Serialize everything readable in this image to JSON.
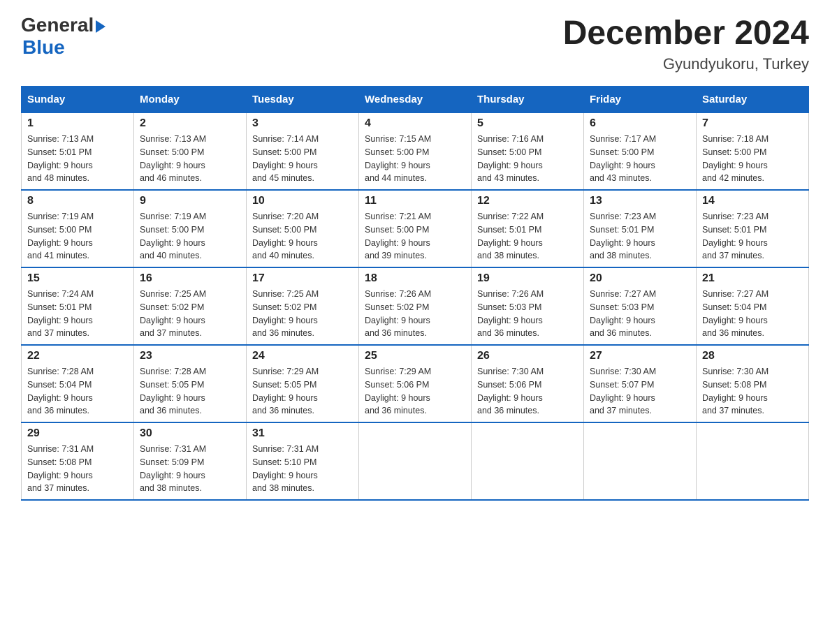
{
  "logo": {
    "text_general": "General",
    "text_blue": "Blue",
    "arrow": "▶"
  },
  "title": "December 2024",
  "subtitle": "Gyundyukoru, Turkey",
  "headers": [
    "Sunday",
    "Monday",
    "Tuesday",
    "Wednesday",
    "Thursday",
    "Friday",
    "Saturday"
  ],
  "weeks": [
    [
      {
        "day": "1",
        "sunrise": "7:13 AM",
        "sunset": "5:01 PM",
        "daylight": "9 hours and 48 minutes."
      },
      {
        "day": "2",
        "sunrise": "7:13 AM",
        "sunset": "5:00 PM",
        "daylight": "9 hours and 46 minutes."
      },
      {
        "day": "3",
        "sunrise": "7:14 AM",
        "sunset": "5:00 PM",
        "daylight": "9 hours and 45 minutes."
      },
      {
        "day": "4",
        "sunrise": "7:15 AM",
        "sunset": "5:00 PM",
        "daylight": "9 hours and 44 minutes."
      },
      {
        "day": "5",
        "sunrise": "7:16 AM",
        "sunset": "5:00 PM",
        "daylight": "9 hours and 43 minutes."
      },
      {
        "day": "6",
        "sunrise": "7:17 AM",
        "sunset": "5:00 PM",
        "daylight": "9 hours and 43 minutes."
      },
      {
        "day": "7",
        "sunrise": "7:18 AM",
        "sunset": "5:00 PM",
        "daylight": "9 hours and 42 minutes."
      }
    ],
    [
      {
        "day": "8",
        "sunrise": "7:19 AM",
        "sunset": "5:00 PM",
        "daylight": "9 hours and 41 minutes."
      },
      {
        "day": "9",
        "sunrise": "7:19 AM",
        "sunset": "5:00 PM",
        "daylight": "9 hours and 40 minutes."
      },
      {
        "day": "10",
        "sunrise": "7:20 AM",
        "sunset": "5:00 PM",
        "daylight": "9 hours and 40 minutes."
      },
      {
        "day": "11",
        "sunrise": "7:21 AM",
        "sunset": "5:00 PM",
        "daylight": "9 hours and 39 minutes."
      },
      {
        "day": "12",
        "sunrise": "7:22 AM",
        "sunset": "5:01 PM",
        "daylight": "9 hours and 38 minutes."
      },
      {
        "day": "13",
        "sunrise": "7:23 AM",
        "sunset": "5:01 PM",
        "daylight": "9 hours and 38 minutes."
      },
      {
        "day": "14",
        "sunrise": "7:23 AM",
        "sunset": "5:01 PM",
        "daylight": "9 hours and 37 minutes."
      }
    ],
    [
      {
        "day": "15",
        "sunrise": "7:24 AM",
        "sunset": "5:01 PM",
        "daylight": "9 hours and 37 minutes."
      },
      {
        "day": "16",
        "sunrise": "7:25 AM",
        "sunset": "5:02 PM",
        "daylight": "9 hours and 37 minutes."
      },
      {
        "day": "17",
        "sunrise": "7:25 AM",
        "sunset": "5:02 PM",
        "daylight": "9 hours and 36 minutes."
      },
      {
        "day": "18",
        "sunrise": "7:26 AM",
        "sunset": "5:02 PM",
        "daylight": "9 hours and 36 minutes."
      },
      {
        "day": "19",
        "sunrise": "7:26 AM",
        "sunset": "5:03 PM",
        "daylight": "9 hours and 36 minutes."
      },
      {
        "day": "20",
        "sunrise": "7:27 AM",
        "sunset": "5:03 PM",
        "daylight": "9 hours and 36 minutes."
      },
      {
        "day": "21",
        "sunrise": "7:27 AM",
        "sunset": "5:04 PM",
        "daylight": "9 hours and 36 minutes."
      }
    ],
    [
      {
        "day": "22",
        "sunrise": "7:28 AM",
        "sunset": "5:04 PM",
        "daylight": "9 hours and 36 minutes."
      },
      {
        "day": "23",
        "sunrise": "7:28 AM",
        "sunset": "5:05 PM",
        "daylight": "9 hours and 36 minutes."
      },
      {
        "day": "24",
        "sunrise": "7:29 AM",
        "sunset": "5:05 PM",
        "daylight": "9 hours and 36 minutes."
      },
      {
        "day": "25",
        "sunrise": "7:29 AM",
        "sunset": "5:06 PM",
        "daylight": "9 hours and 36 minutes."
      },
      {
        "day": "26",
        "sunrise": "7:30 AM",
        "sunset": "5:06 PM",
        "daylight": "9 hours and 36 minutes."
      },
      {
        "day": "27",
        "sunrise": "7:30 AM",
        "sunset": "5:07 PM",
        "daylight": "9 hours and 37 minutes."
      },
      {
        "day": "28",
        "sunrise": "7:30 AM",
        "sunset": "5:08 PM",
        "daylight": "9 hours and 37 minutes."
      }
    ],
    [
      {
        "day": "29",
        "sunrise": "7:31 AM",
        "sunset": "5:08 PM",
        "daylight": "9 hours and 37 minutes."
      },
      {
        "day": "30",
        "sunrise": "7:31 AM",
        "sunset": "5:09 PM",
        "daylight": "9 hours and 38 minutes."
      },
      {
        "day": "31",
        "sunrise": "7:31 AM",
        "sunset": "5:10 PM",
        "daylight": "9 hours and 38 minutes."
      },
      null,
      null,
      null,
      null
    ]
  ],
  "labels": {
    "sunrise": "Sunrise:",
    "sunset": "Sunset:",
    "daylight": "Daylight:"
  }
}
